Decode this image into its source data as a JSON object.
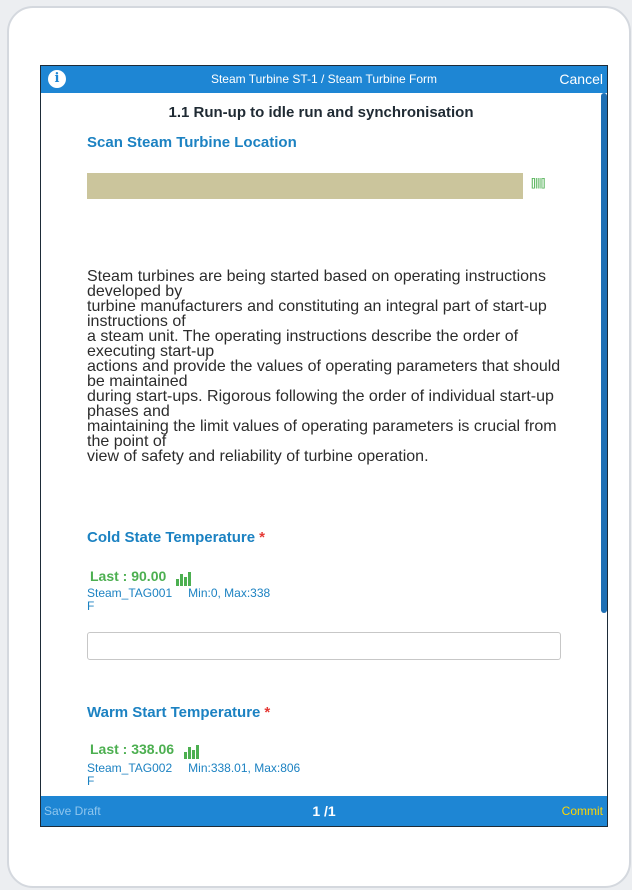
{
  "header": {
    "info_icon": "info-icon",
    "title": "Steam Turbine ST-1 / Steam Turbine Form",
    "cancel_label": "Cancel"
  },
  "form": {
    "section_title": "1.1 Run-up to idle run and synchronisation",
    "scan_field": {
      "label": "Scan Steam Turbine Location",
      "value": "",
      "icon": "barcode-scan-icon",
      "icon_glyph": "[|||||]"
    },
    "description_lines": [
      "Steam turbines are being started based on operating instructions developed by",
      "turbine manufacturers and constituting an integral part of start-up instructions of",
      "a steam unit. The operating instructions describe the order of executing start-up",
      "actions and provide the values of operating parameters that should be maintained",
      "during start-ups. Rigorous following the order of individual start-up phases and",
      "maintaining the limit values of operating parameters is crucial from the point of",
      "view of safety and reliability of turbine operation."
    ],
    "fields": [
      {
        "label": "Cold State Temperature",
        "required_mark": "*",
        "last": "Last : 90.00",
        "tag": "Steam_TAG001",
        "range": "Min:0, Max:338",
        "unit": "F",
        "value": ""
      },
      {
        "label": "Warm Start Temperature",
        "required_mark": "*",
        "last": "Last : 338.06",
        "tag": "Steam_TAG002",
        "range": "Min:338.01, Max:806",
        "unit": "F",
        "value": ""
      }
    ]
  },
  "footer": {
    "save_draft_label": "Save Draft",
    "page_indicator": "1 /1",
    "commit_label": "Commit"
  },
  "colors": {
    "accent": "#1e86d4",
    "label_blue": "#1c82c2",
    "success_green": "#4caf50",
    "required_red": "#e53935",
    "commit_yellow": "#ffd600",
    "scan_field_fill": "#cbc59c"
  }
}
